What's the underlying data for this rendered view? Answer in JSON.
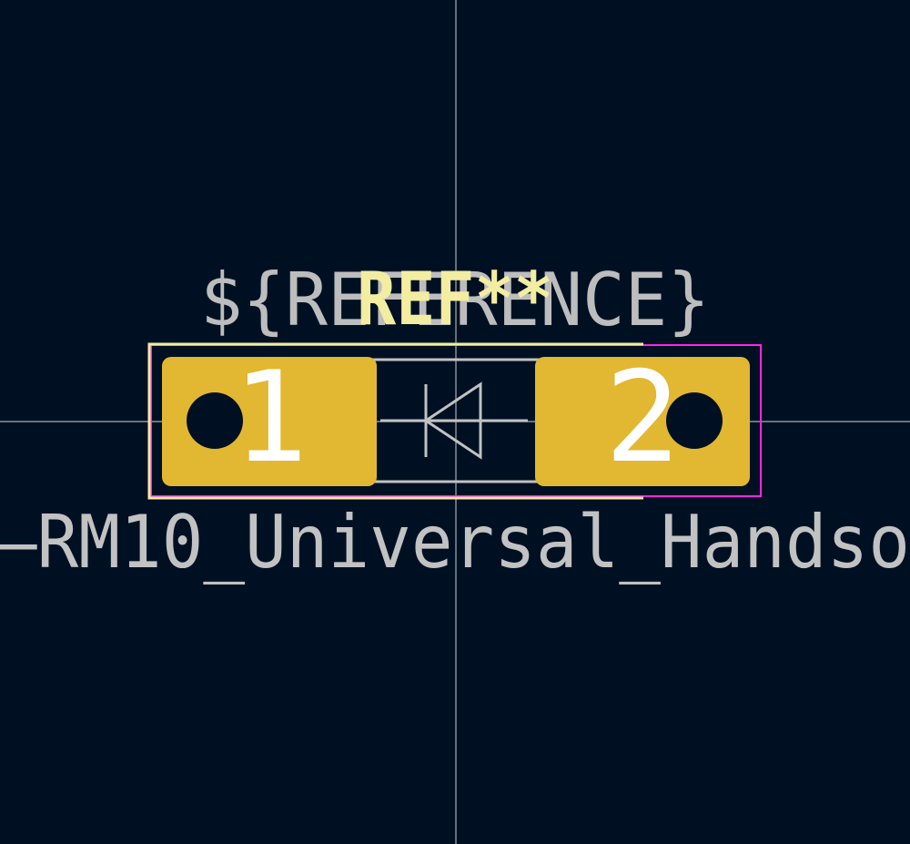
{
  "viewer": {
    "background_color": "#001023",
    "crosshair_color": "#c8c8c8"
  },
  "footprint": {
    "reference_field_text": "${REFERENCE}",
    "reference_designator": "REF**",
    "value_text": "—RM10_Universal_Handso",
    "pads": [
      {
        "number": "1",
        "shape": "rounded-rect",
        "has_hole": true
      },
      {
        "number": "2",
        "shape": "rounded-rect",
        "has_hole": true
      }
    ],
    "symbol": "diode-icon",
    "colors": {
      "pad": "#e2b731",
      "pad_number": "#ffffff",
      "silkscreen": "#f2eda1",
      "fab_outline": "#c2c2c2",
      "courtyard": "#ff26e2",
      "hole": "#001023"
    }
  }
}
